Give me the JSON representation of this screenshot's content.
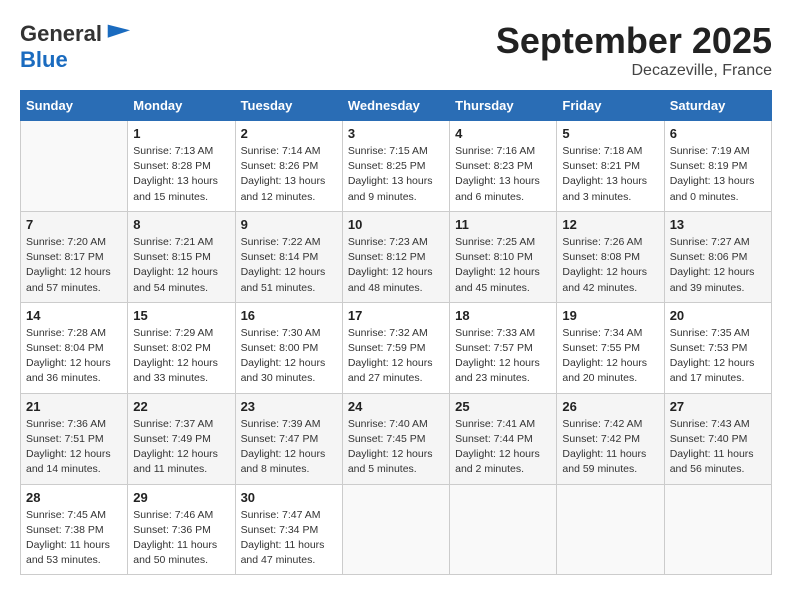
{
  "header": {
    "logo_general": "General",
    "logo_blue": "Blue",
    "month": "September 2025",
    "location": "Decazeville, France"
  },
  "weekdays": [
    "Sunday",
    "Monday",
    "Tuesday",
    "Wednesday",
    "Thursday",
    "Friday",
    "Saturday"
  ],
  "weeks": [
    [
      {
        "day": "",
        "info": ""
      },
      {
        "day": "1",
        "info": "Sunrise: 7:13 AM\nSunset: 8:28 PM\nDaylight: 13 hours\nand 15 minutes."
      },
      {
        "day": "2",
        "info": "Sunrise: 7:14 AM\nSunset: 8:26 PM\nDaylight: 13 hours\nand 12 minutes."
      },
      {
        "day": "3",
        "info": "Sunrise: 7:15 AM\nSunset: 8:25 PM\nDaylight: 13 hours\nand 9 minutes."
      },
      {
        "day": "4",
        "info": "Sunrise: 7:16 AM\nSunset: 8:23 PM\nDaylight: 13 hours\nand 6 minutes."
      },
      {
        "day": "5",
        "info": "Sunrise: 7:18 AM\nSunset: 8:21 PM\nDaylight: 13 hours\nand 3 minutes."
      },
      {
        "day": "6",
        "info": "Sunrise: 7:19 AM\nSunset: 8:19 PM\nDaylight: 13 hours\nand 0 minutes."
      }
    ],
    [
      {
        "day": "7",
        "info": "Sunrise: 7:20 AM\nSunset: 8:17 PM\nDaylight: 12 hours\nand 57 minutes."
      },
      {
        "day": "8",
        "info": "Sunrise: 7:21 AM\nSunset: 8:15 PM\nDaylight: 12 hours\nand 54 minutes."
      },
      {
        "day": "9",
        "info": "Sunrise: 7:22 AM\nSunset: 8:14 PM\nDaylight: 12 hours\nand 51 minutes."
      },
      {
        "day": "10",
        "info": "Sunrise: 7:23 AM\nSunset: 8:12 PM\nDaylight: 12 hours\nand 48 minutes."
      },
      {
        "day": "11",
        "info": "Sunrise: 7:25 AM\nSunset: 8:10 PM\nDaylight: 12 hours\nand 45 minutes."
      },
      {
        "day": "12",
        "info": "Sunrise: 7:26 AM\nSunset: 8:08 PM\nDaylight: 12 hours\nand 42 minutes."
      },
      {
        "day": "13",
        "info": "Sunrise: 7:27 AM\nSunset: 8:06 PM\nDaylight: 12 hours\nand 39 minutes."
      }
    ],
    [
      {
        "day": "14",
        "info": "Sunrise: 7:28 AM\nSunset: 8:04 PM\nDaylight: 12 hours\nand 36 minutes."
      },
      {
        "day": "15",
        "info": "Sunrise: 7:29 AM\nSunset: 8:02 PM\nDaylight: 12 hours\nand 33 minutes."
      },
      {
        "day": "16",
        "info": "Sunrise: 7:30 AM\nSunset: 8:00 PM\nDaylight: 12 hours\nand 30 minutes."
      },
      {
        "day": "17",
        "info": "Sunrise: 7:32 AM\nSunset: 7:59 PM\nDaylight: 12 hours\nand 27 minutes."
      },
      {
        "day": "18",
        "info": "Sunrise: 7:33 AM\nSunset: 7:57 PM\nDaylight: 12 hours\nand 23 minutes."
      },
      {
        "day": "19",
        "info": "Sunrise: 7:34 AM\nSunset: 7:55 PM\nDaylight: 12 hours\nand 20 minutes."
      },
      {
        "day": "20",
        "info": "Sunrise: 7:35 AM\nSunset: 7:53 PM\nDaylight: 12 hours\nand 17 minutes."
      }
    ],
    [
      {
        "day": "21",
        "info": "Sunrise: 7:36 AM\nSunset: 7:51 PM\nDaylight: 12 hours\nand 14 minutes."
      },
      {
        "day": "22",
        "info": "Sunrise: 7:37 AM\nSunset: 7:49 PM\nDaylight: 12 hours\nand 11 minutes."
      },
      {
        "day": "23",
        "info": "Sunrise: 7:39 AM\nSunset: 7:47 PM\nDaylight: 12 hours\nand 8 minutes."
      },
      {
        "day": "24",
        "info": "Sunrise: 7:40 AM\nSunset: 7:45 PM\nDaylight: 12 hours\nand 5 minutes."
      },
      {
        "day": "25",
        "info": "Sunrise: 7:41 AM\nSunset: 7:44 PM\nDaylight: 12 hours\nand 2 minutes."
      },
      {
        "day": "26",
        "info": "Sunrise: 7:42 AM\nSunset: 7:42 PM\nDaylight: 11 hours\nand 59 minutes."
      },
      {
        "day": "27",
        "info": "Sunrise: 7:43 AM\nSunset: 7:40 PM\nDaylight: 11 hours\nand 56 minutes."
      }
    ],
    [
      {
        "day": "28",
        "info": "Sunrise: 7:45 AM\nSunset: 7:38 PM\nDaylight: 11 hours\nand 53 minutes."
      },
      {
        "day": "29",
        "info": "Sunrise: 7:46 AM\nSunset: 7:36 PM\nDaylight: 11 hours\nand 50 minutes."
      },
      {
        "day": "30",
        "info": "Sunrise: 7:47 AM\nSunset: 7:34 PM\nDaylight: 11 hours\nand 47 minutes."
      },
      {
        "day": "",
        "info": ""
      },
      {
        "day": "",
        "info": ""
      },
      {
        "day": "",
        "info": ""
      },
      {
        "day": "",
        "info": ""
      }
    ]
  ]
}
